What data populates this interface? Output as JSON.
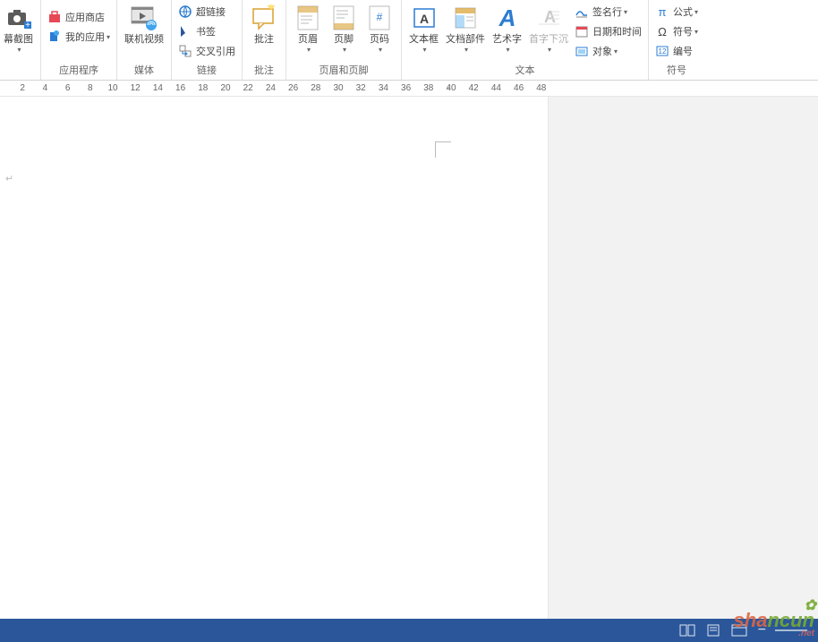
{
  "ribbon": {
    "screenshot": {
      "label": "幕截图"
    },
    "apps": {
      "store": "应用商店",
      "myapps": "我的应用",
      "group_label": "应用程序"
    },
    "media": {
      "online_video": "联机视频",
      "group_label": "媒体"
    },
    "links": {
      "hyperlink": "超链接",
      "bookmark": "书签",
      "crossref": "交叉引用",
      "group_label": "链接"
    },
    "comments": {
      "comment": "批注",
      "group_label": "批注"
    },
    "headerfooter": {
      "header": "页眉",
      "footer": "页脚",
      "pagenum": "页码",
      "group_label": "页眉和页脚"
    },
    "text": {
      "textbox": "文本框",
      "docparts": "文档部件",
      "wordart": "艺术字",
      "dropcap": "首字下沉",
      "signature": "签名行",
      "datetime": "日期和时间",
      "object": "对象",
      "group_label": "文本"
    },
    "symbols": {
      "equation": "公式",
      "symbol": "符号",
      "number": "编号",
      "group_label": "符号"
    }
  },
  "ruler": {
    "marks": [
      2,
      4,
      6,
      8,
      10,
      12,
      14,
      16,
      18,
      20,
      22,
      24,
      26,
      28,
      30,
      32,
      34,
      36,
      38,
      40,
      42,
      44,
      46,
      48
    ]
  },
  "statusbar": {
    "view_read": "阅读视图",
    "view_print": "页面视图",
    "view_web": "Web 版式视图"
  },
  "watermark": {
    "t1": "sha",
    "t2": "ncun",
    "net": ".net"
  }
}
